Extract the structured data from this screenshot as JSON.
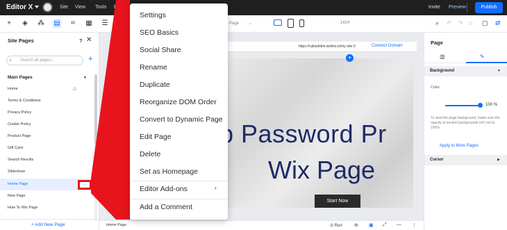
{
  "topbar": {
    "brand": "Editor X",
    "menu": [
      "Site",
      "View",
      "Tools",
      "E"
    ],
    "invite": "Invite",
    "preview": "Preview",
    "publish": "Publish"
  },
  "toolbar": {
    "page_select": "Page",
    "zoom_text": "1424"
  },
  "left_panel": {
    "title": "Site Pages",
    "help": "?",
    "close": "✕",
    "search_placeholder": "Search all pages...",
    "add": "+",
    "section": "Main Pages",
    "pages": [
      {
        "label": "Home"
      },
      {
        "label": "Terms & Conditions"
      },
      {
        "label": "Privacy Policy"
      },
      {
        "label": "Cookie Policy"
      },
      {
        "label": "Product Page"
      },
      {
        "label": "Gift Card"
      },
      {
        "label": "Search Results"
      },
      {
        "label": "Slideshow"
      },
      {
        "label": "Home Page"
      },
      {
        "label": "New Page"
      },
      {
        "label": "How To Wix Page"
      }
    ],
    "more_button": "···",
    "add_new_page": "+ Add New Page"
  },
  "canvas": {
    "site_url": "https://callsidnbin.wixfixs.io/my-site-3",
    "connect_domain": "Connect Domain",
    "hero_line1": "p Password Pr",
    "hero_line2": "Wix Page",
    "hero_button": "Start Now",
    "strip_dots": "···"
  },
  "bottombar": {
    "page_label": "Home Page",
    "run": "Run"
  },
  "right_panel": {
    "title": "Page",
    "background_section": "Background",
    "color_label": "Color",
    "opacity_value": "100",
    "opacity_unit": "%",
    "help_text": "To view the page background, make sure the opacity of section backgrounds isn't set to 100%.",
    "apply_link": "Apply to More Pages",
    "cursor_section": "Cursor"
  },
  "context_menu": {
    "items": [
      "Settings",
      "SEO Basics",
      "Social Share",
      "Rename",
      "Duplicate",
      "Reorganize DOM Order",
      "Convert to Dynamic Page",
      "Edit Page",
      "Delete",
      "Set as Homepage",
      "Editor Add-ons",
      "Add a Comment"
    ],
    "submenu_arrow": "›"
  },
  "colors": {
    "accent": "#116dff",
    "highlight": "#e8141d",
    "topbar": "#202020",
    "hero_text": "#1e2a66"
  }
}
